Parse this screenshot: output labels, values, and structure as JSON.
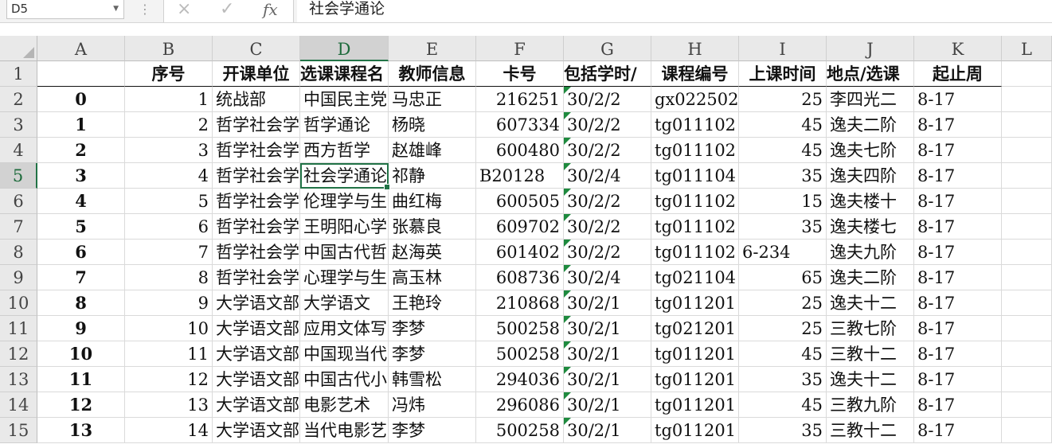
{
  "name_box": "D5",
  "formula_bar": {
    "cancel_icon": "×",
    "confirm_icon": "✓",
    "fx_label": "fx",
    "value": "社会学通论"
  },
  "columns": [
    "A",
    "B",
    "C",
    "D",
    "E",
    "F",
    "G",
    "H",
    "I",
    "J",
    "K",
    "L"
  ],
  "rows": [
    "1",
    "2",
    "3",
    "4",
    "5",
    "6",
    "7",
    "8",
    "9",
    "10",
    "11",
    "12",
    "13",
    "14",
    "15"
  ],
  "header_row": {
    "A": "",
    "B": "序号",
    "C": "开课单位",
    "D": "选课课程名",
    "E": "教师信息",
    "F": "卡号",
    "G": "包括学时/",
    "H": "课程编号",
    "I": "上课时间",
    "J": "地点/选课",
    "K": "起止周"
  },
  "data_rows": [
    {
      "A": "0",
      "B": "1",
      "C": "统战部",
      "D": "中国民主党",
      "E": "马忠正",
      "F": "216251",
      "G": "30/2/2",
      "H": "gx022502",
      "I": "25",
      "J": "李四光二",
      "K": "8-17"
    },
    {
      "A": "1",
      "B": "2",
      "C": "哲学社会学",
      "D": "哲学通论",
      "E": "杨晓",
      "F": "607334",
      "G": "30/2/2",
      "H": "tg011102",
      "I": "45",
      "J": "逸夫二阶",
      "K": "8-17"
    },
    {
      "A": "2",
      "B": "3",
      "C": "哲学社会学",
      "D": "西方哲学",
      "E": "赵雄峰",
      "F": "600480",
      "G": "30/2/2",
      "H": "tg011102",
      "I": "45",
      "J": "逸夫七阶",
      "K": "8-17"
    },
    {
      "A": "3",
      "B": "4",
      "C": "哲学社会学",
      "D": "社会学通论",
      "E": "祁静",
      "F": "B20128",
      "G": "30/2/4",
      "H": "tg011104",
      "I": "35",
      "J": "逸夫四阶",
      "K": "8-17"
    },
    {
      "A": "4",
      "B": "5",
      "C": "哲学社会学",
      "D": "伦理学与生",
      "E": "曲红梅",
      "F": "600505",
      "G": "30/2/2",
      "H": "tg011102",
      "I": "15",
      "J": "逸夫楼十",
      "K": "8-17"
    },
    {
      "A": "5",
      "B": "6",
      "C": "哲学社会学",
      "D": "王明阳心学",
      "E": "张慕良",
      "F": "609702",
      "G": "30/2/2",
      "H": "tg011102",
      "I": "35",
      "J": "逸夫楼七",
      "K": "8-17"
    },
    {
      "A": "6",
      "B": "7",
      "C": "哲学社会学",
      "D": "中国古代哲",
      "E": "赵海英",
      "F": "601402",
      "G": "30/2/2",
      "H": "tg011102",
      "I": "6-234",
      "J": "逸夫九阶",
      "K": "8-17"
    },
    {
      "A": "7",
      "B": "8",
      "C": "哲学社会学",
      "D": "心理学与生",
      "E": "高玉林",
      "F": "608736",
      "G": "30/2/4",
      "H": "tg021104",
      "I": "65",
      "J": "逸夫二阶",
      "K": "8-17"
    },
    {
      "A": "8",
      "B": "9",
      "C": "大学语文部",
      "D": "大学语文",
      "E": "王艳玲",
      "F": "210868",
      "G": "30/2/1",
      "H": "tg011201",
      "I": "25",
      "J": "逸夫十二",
      "K": "8-17"
    },
    {
      "A": "9",
      "B": "10",
      "C": "大学语文部",
      "D": "应用文体写",
      "E": "李梦",
      "F": "500258",
      "G": "30/2/1",
      "H": "tg021201",
      "I": "25",
      "J": "三教七阶",
      "K": "8-17"
    },
    {
      "A": "10",
      "B": "11",
      "C": "大学语文部",
      "D": "中国现当代",
      "E": "李梦",
      "F": "500258",
      "G": "30/2/1",
      "H": "tg011201",
      "I": "45",
      "J": "三教十二",
      "K": "8-17"
    },
    {
      "A": "11",
      "B": "12",
      "C": "大学语文部",
      "D": "中国古代小",
      "E": "韩雪松",
      "F": "294036",
      "G": "30/2/1",
      "H": "tg011201",
      "I": "35",
      "J": "逸夫十二",
      "K": "8-17"
    },
    {
      "A": "12",
      "B": "13",
      "C": "大学语文部",
      "D": "电影艺术",
      "E": "冯炜",
      "F": "296086",
      "G": "30/2/1",
      "H": "tg011201",
      "I": "45",
      "J": "三教九阶",
      "K": "8-17"
    },
    {
      "A": "13",
      "B": "14",
      "C": "大学语文部",
      "D": "当代电影艺",
      "E": "李梦",
      "F": "500258",
      "G": "30/2/1",
      "H": "tg011201",
      "I": "35",
      "J": "三教十二",
      "K": "8-17"
    }
  ],
  "colors": {
    "accent": "#217346",
    "header_bg": "#e9e9e9",
    "gridline": "#dadada"
  }
}
